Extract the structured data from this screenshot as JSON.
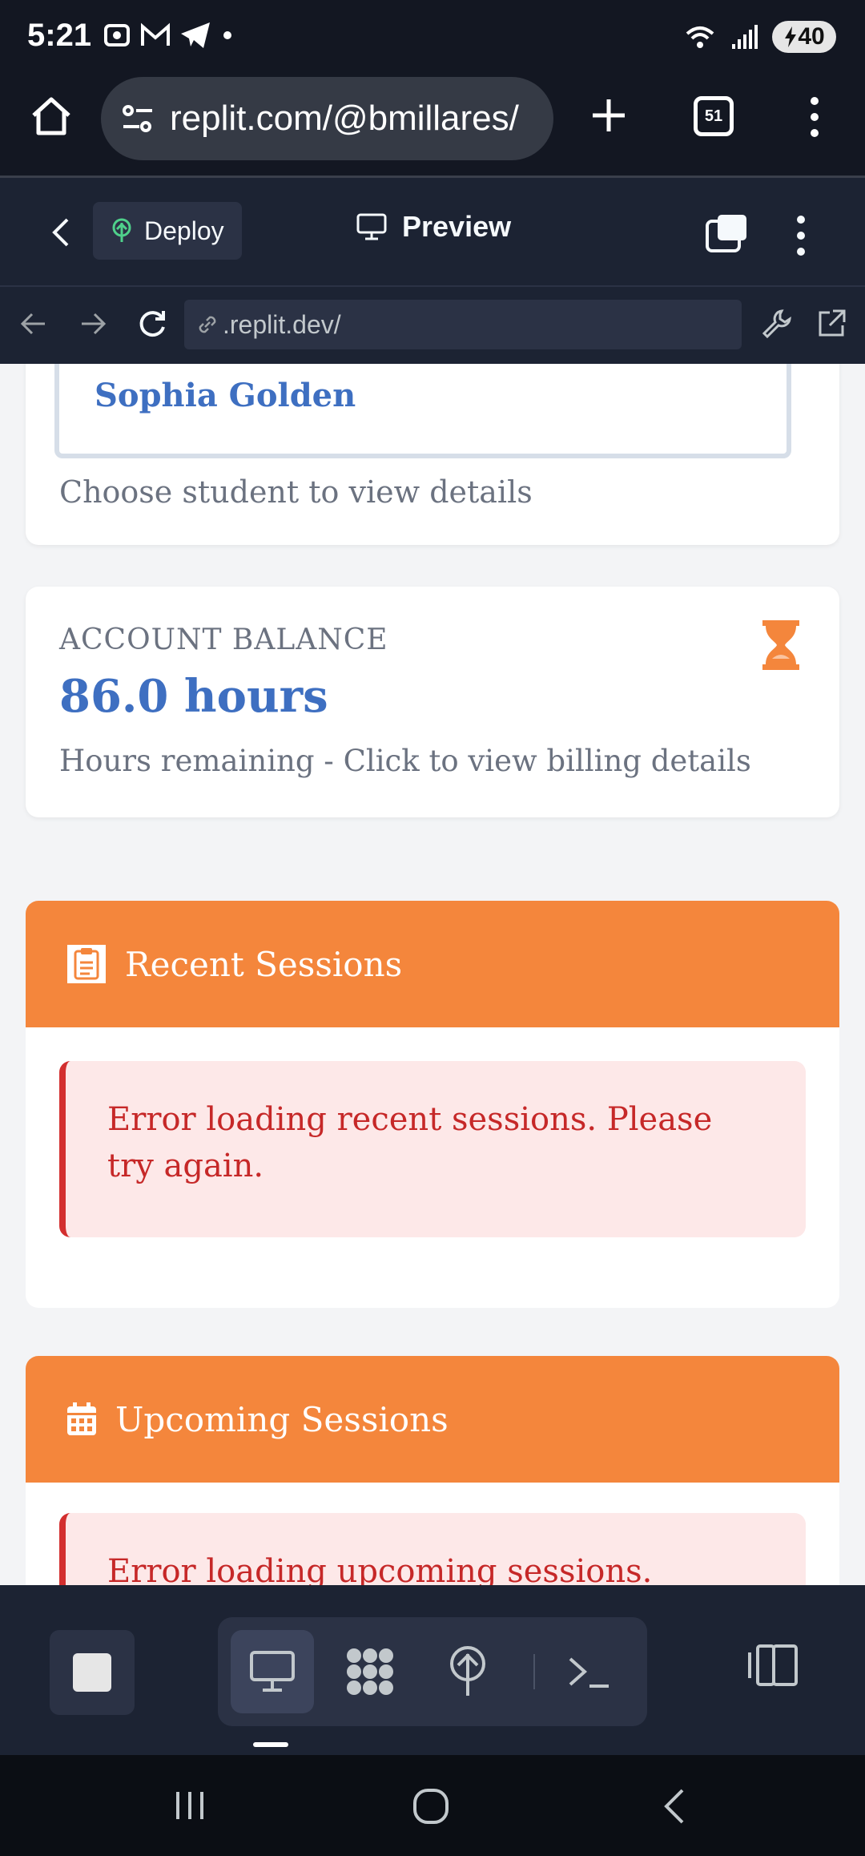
{
  "status_bar": {
    "time": "5:21",
    "battery": "40",
    "icons": [
      "screenshot-icon",
      "gmail-icon",
      "telegram-icon",
      "dot-icon",
      "wifi-icon",
      "signal-icon",
      "battery-icon"
    ]
  },
  "browser": {
    "url": "replit.com/@bmillares/",
    "tab_count": "51"
  },
  "replit_header": {
    "deploy_label": "Deploy",
    "preview_label": "Preview"
  },
  "webview": {
    "address": ".replit.dev/"
  },
  "student_card": {
    "selected_student": "Sophia Golden",
    "helper": "Choose student to view details"
  },
  "balance_card": {
    "label": "ACCOUNT BALANCE",
    "value": "86.0 hours",
    "note": "Hours remaining - Click to view billing details"
  },
  "recent_sessions": {
    "title": "Recent Sessions",
    "error": "Error loading recent sessions. Please try again."
  },
  "upcoming_sessions": {
    "title": "Upcoming Sessions",
    "error": "Error loading upcoming sessions. Please try again."
  },
  "colors": {
    "accent_orange": "#f4863c",
    "link_blue": "#3e6fc1",
    "error_red": "#c62828",
    "error_bg": "#fde8e8",
    "replit_dark": "#1c2333"
  }
}
